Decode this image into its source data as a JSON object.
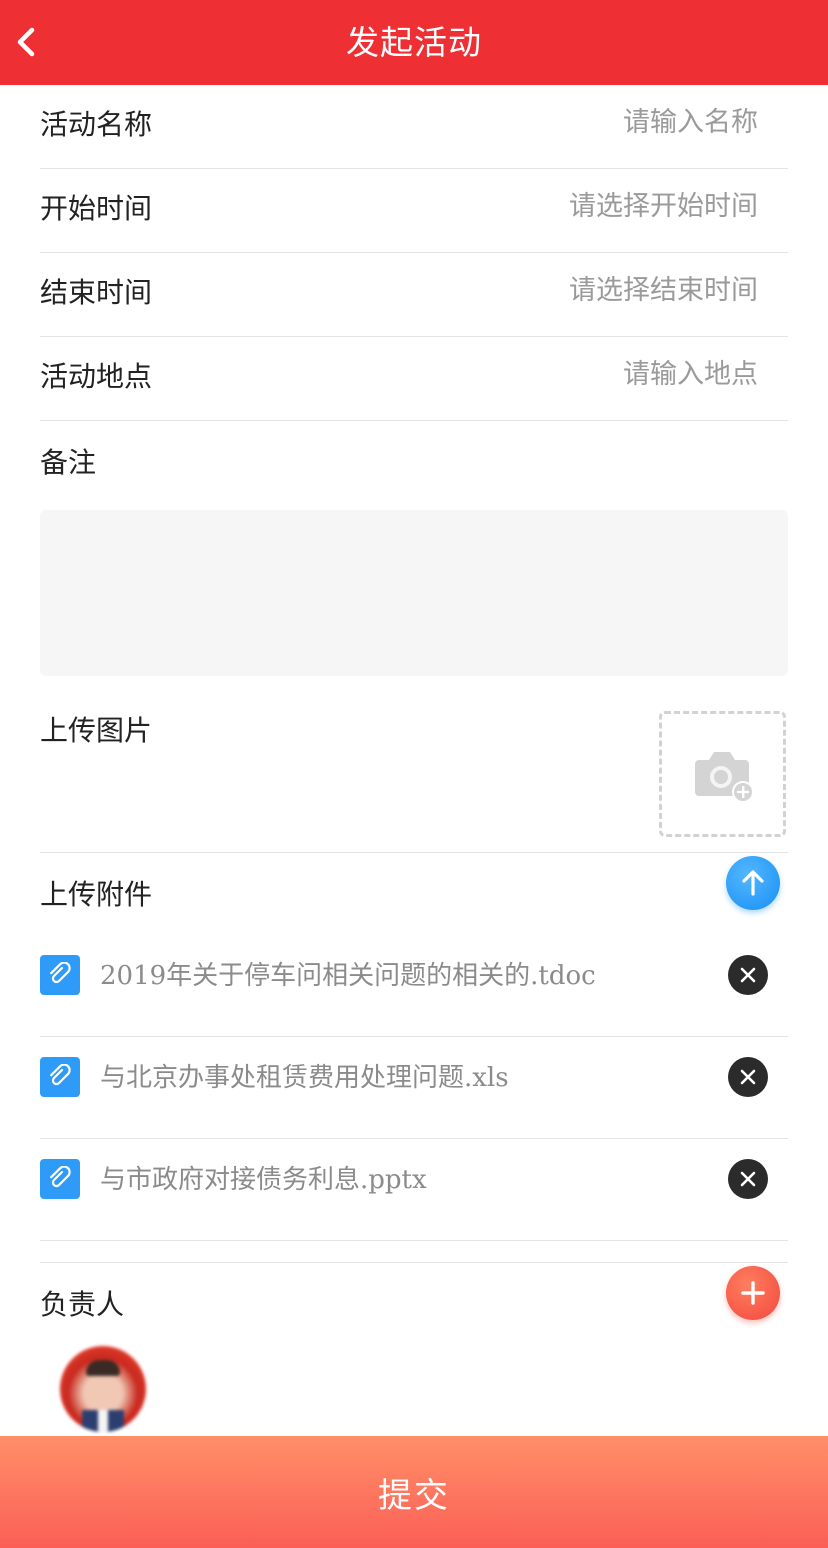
{
  "header": {
    "title": "发起活动",
    "back_icon": "chevron-left-icon"
  },
  "fields": [
    {
      "label": "活动名称",
      "placeholder": "请输入名称"
    },
    {
      "label": "开始时间",
      "placeholder": "请选择开始时间"
    },
    {
      "label": "结束时间",
      "placeholder": "请选择结束时间"
    },
    {
      "label": "活动地点",
      "placeholder": "请输入地点"
    }
  ],
  "notes": {
    "label": "备注"
  },
  "upload_image": {
    "label": "上传图片",
    "icon": "camera-add-icon"
  },
  "attachments": {
    "label": "上传附件",
    "upload_icon": "arrow-up-icon",
    "files": [
      {
        "name": "2019年关于停车问相关问题的相关的.tdoc"
      },
      {
        "name": "与北京办事处租赁费用处理问题.xls"
      },
      {
        "name": "与市政府对接债务利息.pptx"
      }
    ]
  },
  "owner": {
    "label": "负责人",
    "add_icon": "plus-icon"
  },
  "submit": {
    "label": "提交"
  },
  "colors": {
    "header": "#ee3034",
    "upload_button": "#178ff4",
    "add_button": "#f2483e",
    "submit_gradient_top": "#ff8f68",
    "submit_gradient_bottom": "#fb5f56"
  }
}
